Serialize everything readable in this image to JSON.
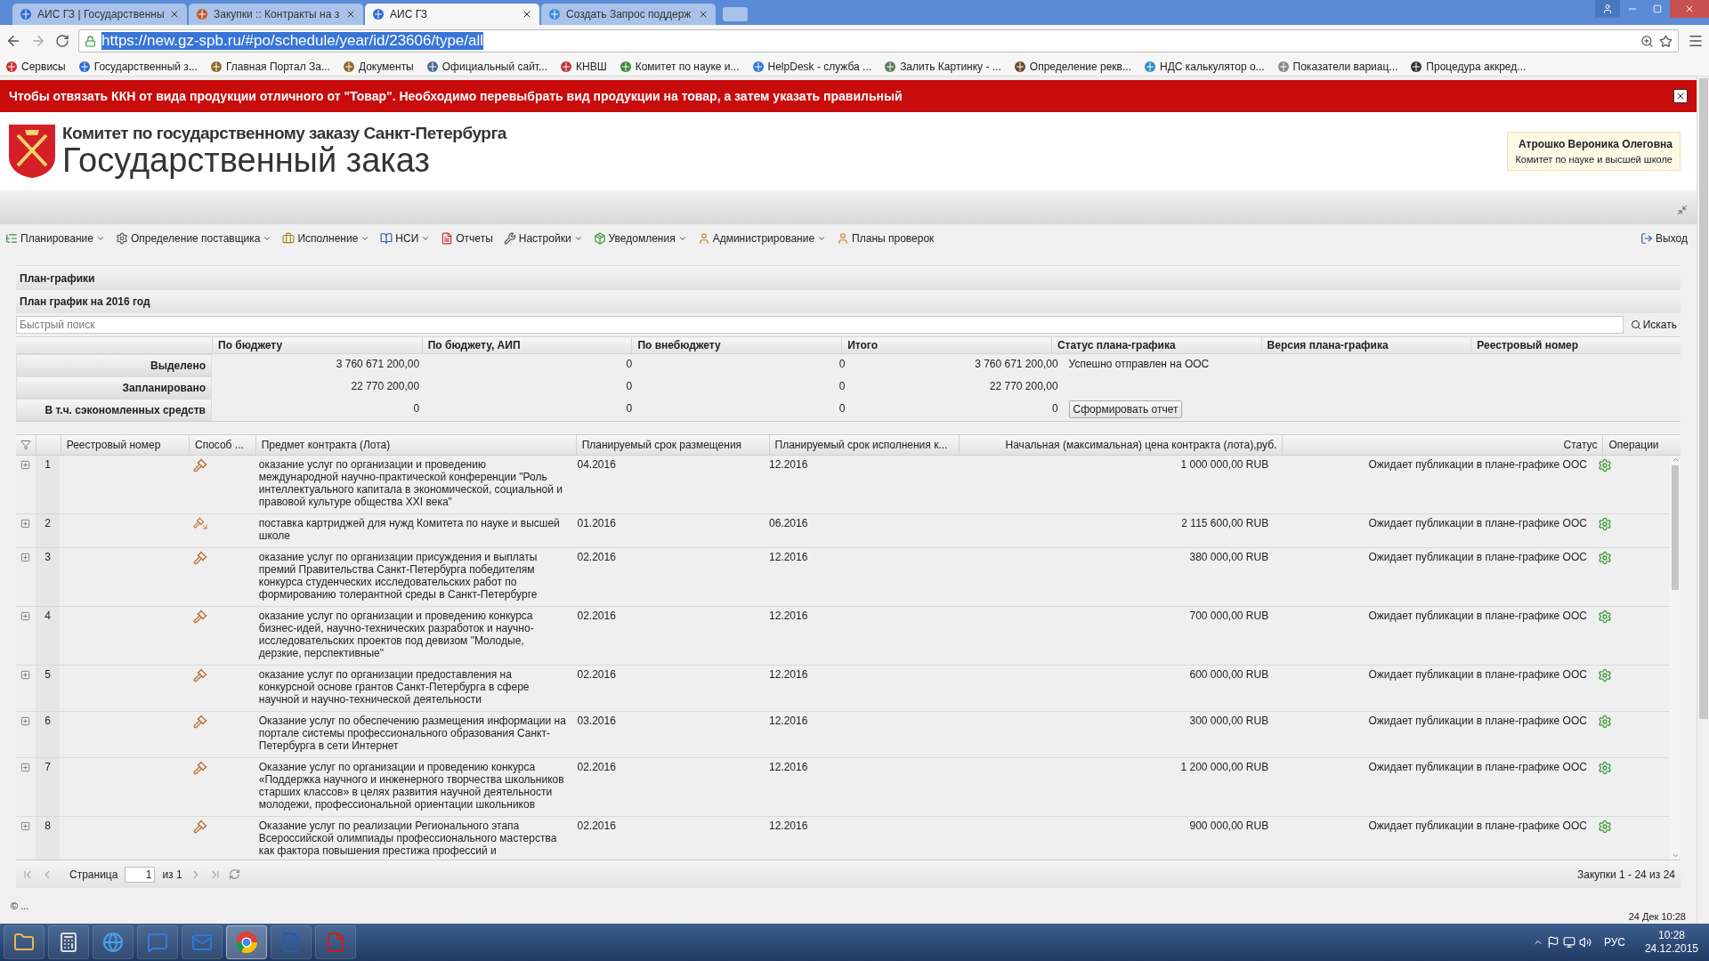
{
  "browser": {
    "tabs": [
      {
        "title": "АИС ГЗ | Государственны",
        "selected": false
      },
      {
        "title": "Закупки :: Контракты на з",
        "selected": false
      },
      {
        "title": "АИС ГЗ",
        "selected": true
      },
      {
        "title": "Создать Запрос поддерж",
        "selected": false
      }
    ],
    "url": "https://new.gz-spb.ru/#po/schedule/year/id/23606/type/all",
    "bookmarks": [
      "Сервисы",
      "Государственный з...",
      "Главная Портал За...",
      "Документы",
      "Официальный сайт...",
      "КНВШ",
      "Комитет по науке и...",
      "HelpDesk - служба ...",
      "Залить Картинку - ...",
      "Определение рекв...",
      "НДС калькулятор о...",
      "Показатели вариац...",
      "Процедура аккред..."
    ]
  },
  "banner": {
    "text": "Чтобы отвязать ККН от вида продукции отличного от \"Товар\". Необходимо перевыбрать вид продукции на товар, а затем указать правильный"
  },
  "header": {
    "org": "Комитет по государственному заказу Санкт-Петербурга",
    "title": "Государственный заказ",
    "user": {
      "name": "Атрошко Вероника Олеговна",
      "dept": "Комитет по науке и высшей школе"
    }
  },
  "menu": {
    "items": [
      {
        "label": "Планирование",
        "dropdown": true
      },
      {
        "label": "Определение поставщика",
        "dropdown": true
      },
      {
        "label": "Исполнение",
        "dropdown": true
      },
      {
        "label": "НСИ",
        "dropdown": true
      },
      {
        "label": "Отчеты",
        "dropdown": false
      },
      {
        "label": "Настройки",
        "dropdown": true
      },
      {
        "label": "Уведомления",
        "dropdown": true
      },
      {
        "label": "Администрирование",
        "dropdown": true
      },
      {
        "label": "Планы проверок",
        "dropdown": false
      }
    ],
    "logout": "Выход"
  },
  "panel": {
    "title": "План-графики",
    "subtitle": "План график на 2016 год",
    "search": {
      "placeholder": "Быстрый поиск",
      "button": "Искать"
    }
  },
  "summary": {
    "columns": [
      "По бюджету",
      "По бюджету, АИП",
      "По внебюджету",
      "Итого",
      "Статус плана-графика",
      "Версия плана-графика",
      "Реестровый номер"
    ],
    "rows": [
      {
        "label": "Выделено",
        "values": [
          "3 760 671 200,00",
          "0",
          "0",
          "3 760 671 200,00"
        ],
        "status": "Успешно отправлен на ООС"
      },
      {
        "label": "Запланировано",
        "values": [
          "22 770 200,00",
          "0",
          "0",
          "22 770 200,00"
        ]
      },
      {
        "label": "В т.ч. сэкономленных средств",
        "values": [
          "0",
          "0",
          "0",
          "0"
        ],
        "action": "Сформировать отчет"
      }
    ]
  },
  "grid": {
    "columns": [
      "Реестровый номер",
      "Способ ...",
      "Предмет контракта (Лота)",
      "Планируемый срок размещения",
      "Планируемый срок исполнения к...",
      "Начальная (максимальная) цена контракта (лота),руб.",
      "Статус",
      "Операции"
    ],
    "rows": [
      {
        "num": "1",
        "kind": "gavel",
        "subject": "оказание услуг по организации и проведению международной научно-практической конференции \"Роль интеллектуального капитала в экономической, социальной и правовой культуре общества XXI века\"",
        "placement": "04.2016",
        "execution": "12.2016",
        "price": "1 000 000,00 RUB",
        "status": "Ожидает публикации в плане-графике ООС"
      },
      {
        "num": "2",
        "kind": "arrow",
        "subject": "поставка картриджей для нужд Комитета по науке и высшей школе",
        "placement": "01.2016",
        "execution": "06.2016",
        "price": "2 115 600,00 RUB",
        "status": "Ожидает публикации в плане-графике ООС"
      },
      {
        "num": "3",
        "kind": "gavel",
        "subject": "оказание услуг по организации присуждения и выплаты премий Правительства Санкт-Петербурга победителям конкурса студенческих исследовательских работ по формированию толерантной среды в Санкт-Петербурге",
        "placement": "02.2016",
        "execution": "12.2016",
        "price": "380 000,00 RUB",
        "status": "Ожидает публикации в плане-графике ООС"
      },
      {
        "num": "4",
        "kind": "gavel",
        "subject": "оказание услуг по организации и проведению конкурса бизнес-идей, научно-технических разработок и научно-исследовательских проектов под девизом \"Молодые, дерзкие, перспективные\"",
        "placement": "02.2016",
        "execution": "12.2016",
        "price": "700 000,00 RUB",
        "status": "Ожидает публикации в плане-графике ООС"
      },
      {
        "num": "5",
        "kind": "gavel",
        "subject": "оказание услуг по организации предоставления на конкурсной основе грантов Санкт-Петербурга в сфере научной и научно-технической деятельности",
        "placement": "02.2016",
        "execution": "12.2016",
        "price": "600 000,00 RUB",
        "status": "Ожидает публикации в плане-графике ООС"
      },
      {
        "num": "6",
        "kind": "gavel",
        "subject": "Оказание услуг по обеспечению размещения информации на портале системы профессионального образования Санкт-Петербурга в сети Интернет",
        "placement": "03.2016",
        "execution": "12.2016",
        "price": "300 000,00 RUB",
        "status": "Ожидает публикации в плане-графике ООС"
      },
      {
        "num": "7",
        "kind": "gavel",
        "subject": "Оказание услуг по организации и проведению конкурса «Поддержка научного и инженерного творчества школьников старших классов» в целях развития научной деятельности молодежи, профессиональной ориентации школьников",
        "placement": "02.2016",
        "execution": "12.2016",
        "price": "1 200 000,00 RUB",
        "status": "Ожидает публикации в плане-графике ООС"
      },
      {
        "num": "8",
        "kind": "gavel",
        "subject": "Оказание услуг по реализации Регионального этапа Всероссийской олимпиады профессионального мастерства как фактора повышения престижа профессий и",
        "placement": "02.2016",
        "execution": "12.2016",
        "price": "900 000,00 RUB",
        "status": "Ожидает публикации в плане-графике ООС"
      }
    ]
  },
  "pager": {
    "page_label": "Страница",
    "page": "1",
    "of": "из 1",
    "summary": "Закупки 1 - 24 из 24"
  },
  "status_bar": {
    "left": "© ...",
    "right": "24 Дек 10:28"
  },
  "taskbar": {
    "apps": [
      {
        "selected": false
      },
      {
        "selected": false
      },
      {
        "selected": false
      },
      {
        "selected": false
      },
      {
        "selected": false
      },
      {
        "selected": true
      },
      {
        "selected": false
      },
      {
        "selected": false
      }
    ],
    "lang": "РУС",
    "time": "10:28",
    "date": "24.12.2015"
  }
}
